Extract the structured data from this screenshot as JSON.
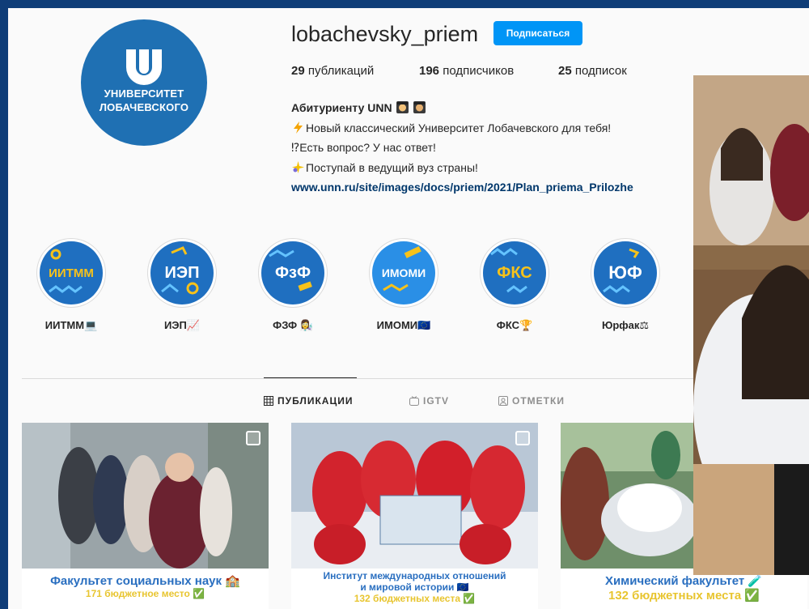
{
  "profile": {
    "username": "lobachevsky_priem",
    "follow_label": "Подписаться",
    "logo_line1": "УНИВЕРСИТЕТ",
    "logo_line2": "ЛОБАЧЕВСКОГО",
    "stats": [
      {
        "count": "29",
        "label": "публикаций"
      },
      {
        "count": "196",
        "label": "подписчиков"
      },
      {
        "count": "25",
        "label": "подписок"
      }
    ],
    "bio": {
      "name": "Абитуриенту UNN",
      "line1": "Новый классический Университет Лобачевского для тебя!",
      "line2": "⁉Есть вопрос? У нас ответ!",
      "line3": "Поступай в ведущий вуз страны!",
      "link": "www.unn.ru/site/images/docs/priem/2021/Plan_priema_Prilozhe"
    }
  },
  "highlights": [
    {
      "circle_text": "ИИТММ",
      "label": "ИИТММ💻"
    },
    {
      "circle_text": "ИЭП",
      "label": "ИЭП📈"
    },
    {
      "circle_text": "ФзФ",
      "label": "ФЗФ 👩‍🔬"
    },
    {
      "circle_text": "ИМОМИ",
      "label": "ИМОМИ🇪🇺"
    },
    {
      "circle_text": "ФКС",
      "label": "ФКС🏆"
    },
    {
      "circle_text": "ЮФ",
      "label": "Юрфак⚖"
    }
  ],
  "tabs": [
    {
      "label": "ПУБЛИКАЦИИ",
      "icon": "grid-icon",
      "active": true
    },
    {
      "label": "IGTV",
      "icon": "igtv-icon",
      "active": false
    },
    {
      "label": "ОТМЕТКИ",
      "icon": "tagged-icon",
      "active": false
    }
  ],
  "posts": [
    {
      "line1": "Факультет социальных наук 🏫",
      "line2": "171 бюджетное место ✅"
    },
    {
      "line1": "Институт международных отношений",
      "line1b": "и мировой истории 🇪🇺",
      "line2": "132 бюджетных места ✅"
    },
    {
      "line1": "Химический факультет 🧪",
      "line2": "132 бюджетных места ✅"
    }
  ],
  "colors": {
    "accent": "#0095f6",
    "brand_blue": "#1f70b3",
    "link": "#00376b",
    "background": "#0f3d78"
  }
}
